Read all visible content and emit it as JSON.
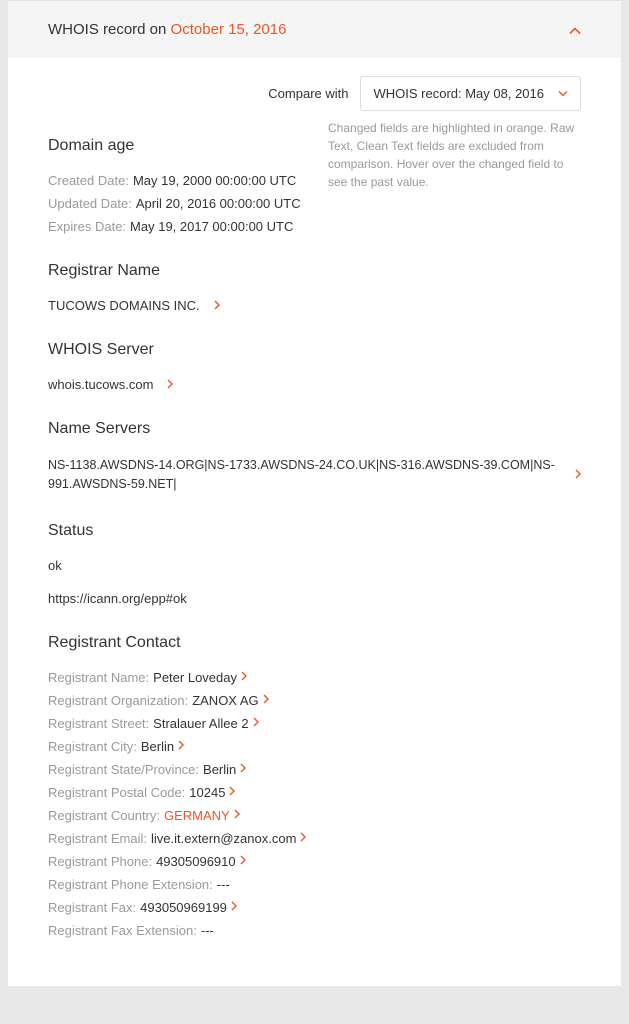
{
  "header": {
    "title_prefix": "WHOIS record on ",
    "title_date": "October 15, 2016"
  },
  "compare": {
    "label": "Compare with",
    "selected": "WHOIS record: May 08, 2016",
    "note": "Changed fields are highlighted in orange. Raw Text, Clean Text fields are excluded from comparison. Hover over the changed field to see the past value."
  },
  "domain_age": {
    "title": "Domain age",
    "created_label": "Created Date:",
    "created_value": "May 19, 2000 00:00:00 UTC",
    "updated_label": "Updated Date:",
    "updated_value": "April 20, 2016 00:00:00 UTC",
    "expires_label": "Expires Date:",
    "expires_value": "May 19, 2017 00:00:00 UTC"
  },
  "registrar": {
    "title": "Registrar Name",
    "value": "TUCOWS DOMAINS INC."
  },
  "whois_server": {
    "title": "WHOIS Server",
    "value": "whois.tucows.com"
  },
  "name_servers": {
    "title": "Name Servers",
    "value": "NS-1138.AWSDNS-14.ORG|NS-1733.AWSDNS-24.CO.UK|NS-316.AWSDNS-39.COM|NS-991.AWSDNS-59.NET|"
  },
  "status": {
    "title": "Status",
    "value1": "ok",
    "value2": "https://icann.org/epp#ok"
  },
  "registrant": {
    "title": "Registrant Contact",
    "name_label": "Registrant Name:",
    "name_value": "Peter Loveday",
    "org_label": "Registrant Organization:",
    "org_value": "ZANOX AG",
    "street_label": "Registrant Street:",
    "street_value": "Stralauer Allee 2",
    "city_label": "Registrant City:",
    "city_value": "Berlin",
    "state_label": "Registrant State/Province:",
    "state_value": "Berlin",
    "postal_label": "Registrant Postal Code:",
    "postal_value": "10245",
    "country_label": "Registrant Country:",
    "country_value": "GERMANY",
    "email_label": "Registrant Email:",
    "email_value": "live.it.extern@zanox.com",
    "phone_label": "Registrant Phone:",
    "phone_value": "49305096910",
    "phone_ext_label": "Registrant Phone Extension:",
    "phone_ext_value": "---",
    "fax_label": "Registrant Fax:",
    "fax_value": "493050969199",
    "fax_ext_label": "Registrant Fax Extension:",
    "fax_ext_value": "---"
  }
}
